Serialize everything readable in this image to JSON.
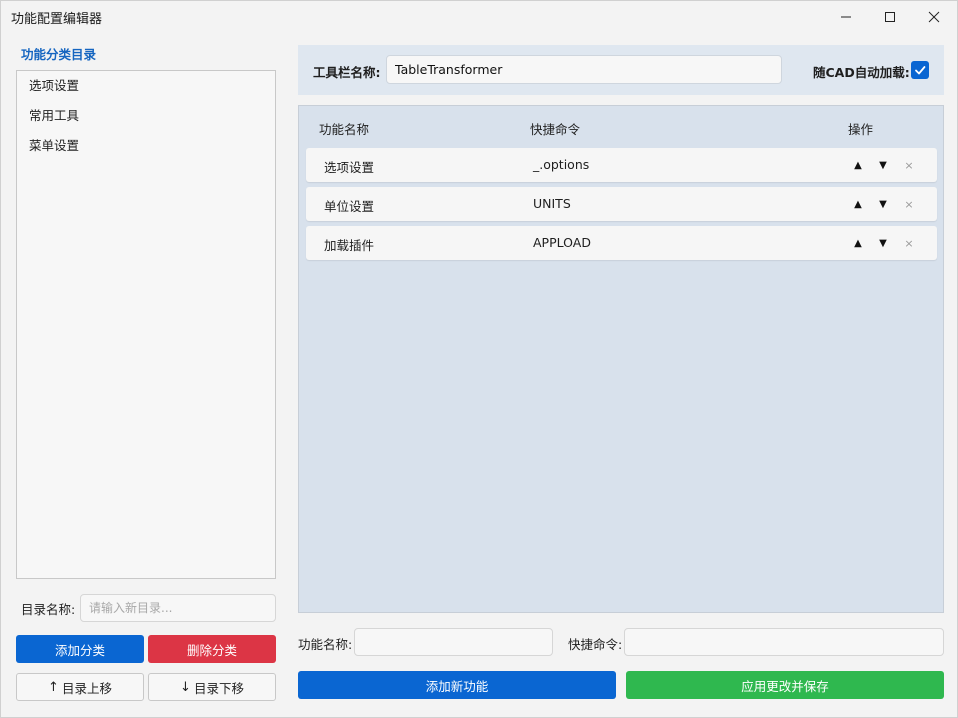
{
  "window": {
    "title": "功能配置编辑器",
    "controls": [
      "minimize-icon",
      "maximize-icon",
      "close-icon"
    ]
  },
  "sidebar": {
    "title": "功能分类目录",
    "items": [
      {
        "label": "选项设置"
      },
      {
        "label": "常用工具"
      },
      {
        "label": "菜单设置"
      }
    ],
    "name_label": "目录名称:",
    "name_placeholder": "请输入新目录...",
    "add_button": "添加分类",
    "delete_button": "删除分类",
    "up_button": "目录上移",
    "up_arrow": "↑",
    "down_button": "目录下移",
    "down_arrow": "↓"
  },
  "toolbar": {
    "name_label": "工具栏名称:",
    "name_value": "TableTransformer",
    "autoload_label": "随CAD自动加载:",
    "autoload_checked": true
  },
  "functions": {
    "headers": {
      "name": "功能名称",
      "command": "快捷命令",
      "ops": "操作"
    },
    "rows": [
      {
        "name": "选项设置",
        "command": "_.options",
        "up": "▲",
        "down": "▼",
        "del": "×"
      },
      {
        "name": "单位设置",
        "command": "UNITS",
        "up": "▲",
        "down": "▼",
        "del": "×"
      },
      {
        "name": "加载插件",
        "command": "APPLOAD",
        "up": "▲",
        "down": "▼",
        "del": "×"
      }
    ]
  },
  "editor": {
    "func_name_label": "功能名称:",
    "func_name_value": "",
    "command_label": "快捷命令:",
    "command_value": "",
    "add_button": "添加新功能",
    "save_button": "应用更改并保存"
  },
  "colors": {
    "accent_blue": "#0a66d2",
    "danger_red": "#dc3545",
    "success_green": "#2fb84f",
    "header_bg": "#dfe7f0",
    "table_bg": "#d8e1ec",
    "title_blue": "#1565c0"
  }
}
